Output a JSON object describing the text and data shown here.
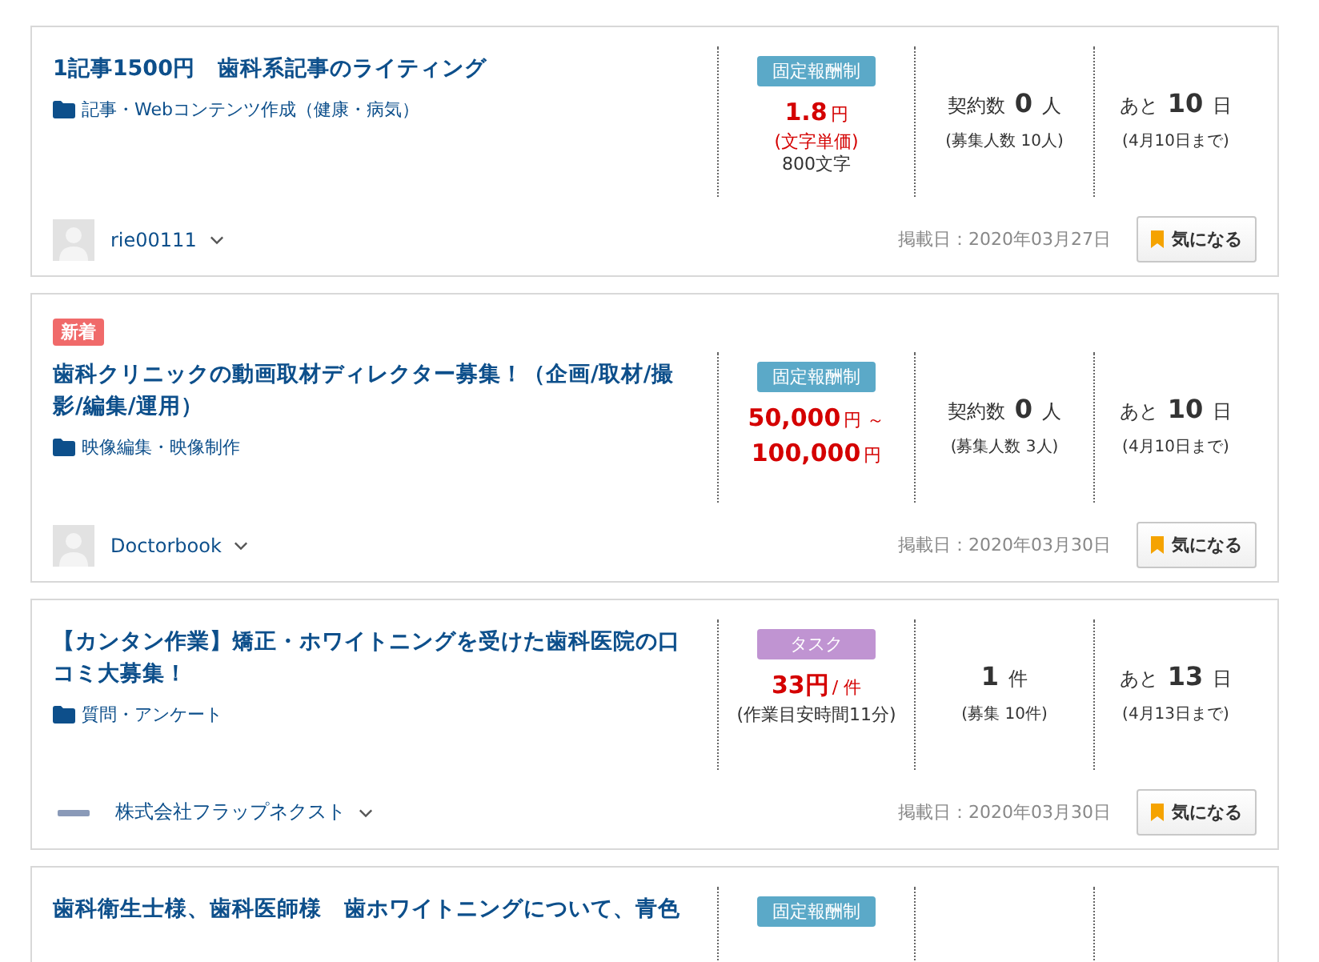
{
  "jobs": [
    {
      "new": false,
      "title": "1記事1500円　歯科系記事のライティング",
      "category": "記事・Webコンテンツ作成（健康・病気）",
      "pay_type": {
        "label": "固定報酬制",
        "kind": "fixed"
      },
      "price": [
        [
          {
            "text": "1.8",
            "kind": "big"
          },
          {
            "text": "円",
            "kind": "unit"
          }
        ],
        [
          {
            "text": "(文字単価)",
            "kind": "red_note"
          }
        ],
        [
          {
            "text": "800文字",
            "kind": "note"
          }
        ]
      ],
      "contracts": {
        "label": "契約数",
        "number": "0",
        "unit": "人",
        "sub": "(募集人数 10人)"
      },
      "deadline": {
        "prefix": "あと",
        "number": "10",
        "unit": "日",
        "sub": "(4月10日まで)"
      },
      "user": {
        "name": "rie00111",
        "kind": "blank"
      },
      "posted": "掲載日：2020年03月27日",
      "button": "気になる"
    },
    {
      "new": true,
      "new_label": "新着",
      "title": "歯科クリニックの動画取材ディレクター募集！（企画/取材/撮影/編集/運用）",
      "category": "映像編集・映像制作",
      "pay_type": {
        "label": "固定報酬制",
        "kind": "fixed"
      },
      "price": [
        [
          {
            "text": "50,000",
            "kind": "big"
          },
          {
            "text": "円 ～",
            "kind": "unit"
          }
        ],
        [
          {
            "text": "100,000",
            "kind": "big"
          },
          {
            "text": "円",
            "kind": "unit"
          }
        ]
      ],
      "contracts": {
        "label": "契約数",
        "number": "0",
        "unit": "人",
        "sub": "(募集人数 3人)"
      },
      "deadline": {
        "prefix": "あと",
        "number": "10",
        "unit": "日",
        "sub": "(4月10日まで)"
      },
      "user": {
        "name": "Doctorbook",
        "kind": "blank"
      },
      "posted": "掲載日：2020年03月30日",
      "button": "気になる"
    },
    {
      "new": false,
      "title": "【カンタン作業】矯正・ホワイトニングを受けた歯科医院の口コミ大募集！",
      "category": "質問・アンケート",
      "pay_type": {
        "label": "タスク",
        "kind": "task"
      },
      "price": [
        [
          {
            "text": "33円",
            "kind": "big"
          },
          {
            "text": "/ 件",
            "kind": "unit"
          }
        ],
        [
          {
            "text": "(作業目安時間11分)",
            "kind": "note"
          }
        ]
      ],
      "contracts": {
        "number": "1",
        "unit": "件",
        "sub": "(募集 10件)"
      },
      "deadline": {
        "prefix": "あと",
        "number": "13",
        "unit": "日",
        "sub": "(4月13日まで)"
      },
      "user": {
        "name": "株式会社フラップネクスト",
        "kind": "logo"
      },
      "posted": "掲載日：2020年03月30日",
      "button": "気になる"
    },
    {
      "new": false,
      "title": "歯科衛生士様、歯科医師様　歯ホワイトニングについて、青色",
      "pay_type": {
        "label": "固定報酬制",
        "kind": "fixed"
      }
    }
  ]
}
